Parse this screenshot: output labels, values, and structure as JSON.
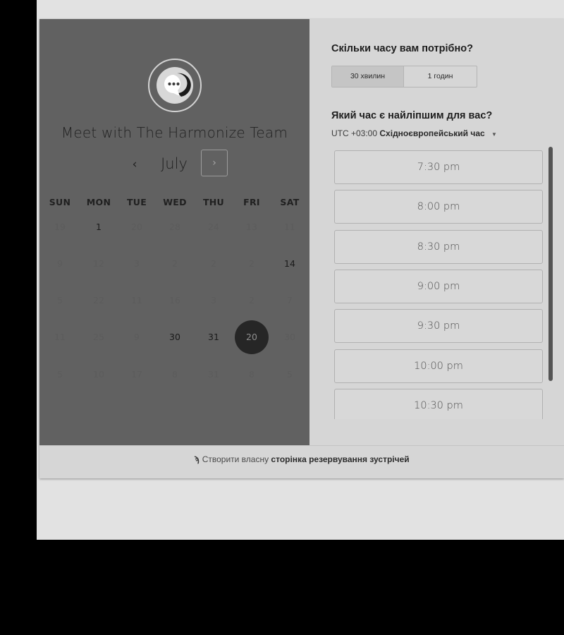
{
  "booking": {
    "title": "Meet with The Harmonize Team",
    "avatar_icon": "chat-bubble-icon",
    "calendar": {
      "month": "July",
      "prev_glyph": "‹",
      "next_glyph": "›",
      "weekdays": [
        "SUN",
        "MON",
        "TUE",
        "WED",
        "THU",
        "FRI",
        "SAT"
      ],
      "weeks": [
        [
          {
            "d": "19",
            "a": false
          },
          {
            "d": "1",
            "a": true
          },
          {
            "d": "20",
            "a": false
          },
          {
            "d": "28",
            "a": false
          },
          {
            "d": "24",
            "a": false
          },
          {
            "d": "13",
            "a": false
          },
          {
            "d": "11",
            "a": false
          }
        ],
        [
          {
            "d": "9",
            "a": false
          },
          {
            "d": "12",
            "a": false
          },
          {
            "d": "3",
            "a": false
          },
          {
            "d": "2",
            "a": false
          },
          {
            "d": "2",
            "a": false
          },
          {
            "d": "2",
            "a": false
          },
          {
            "d": "14",
            "a": true
          }
        ],
        [
          {
            "d": "5",
            "a": false
          },
          {
            "d": "22",
            "a": false
          },
          {
            "d": "11",
            "a": false
          },
          {
            "d": "16",
            "a": false
          },
          {
            "d": "3",
            "a": false
          },
          {
            "d": "2",
            "a": false
          },
          {
            "d": "7",
            "a": false
          }
        ],
        [
          {
            "d": "11",
            "a": false
          },
          {
            "d": "25",
            "a": false
          },
          {
            "d": "9",
            "a": false
          },
          {
            "d": "30",
            "a": true
          },
          {
            "d": "31",
            "a": true
          },
          {
            "d": "20",
            "a": true,
            "sel": true
          },
          {
            "d": "30",
            "a": false
          }
        ],
        [
          {
            "d": "5",
            "a": false
          },
          {
            "d": "10",
            "a": false
          },
          {
            "d": "17",
            "a": false
          },
          {
            "d": "8",
            "a": false
          },
          {
            "d": "31",
            "a": false
          },
          {
            "d": "8",
            "a": false
          },
          {
            "d": "5",
            "a": false
          }
        ]
      ]
    },
    "duration": {
      "heading": "Скільки часу вам потрібно?",
      "options": [
        "30 хвилин",
        "1 годин"
      ],
      "selected": 0
    },
    "time": {
      "heading": "Який час є найліпшим для вас?",
      "tz_prefix": "UTC +03:00",
      "tz_name": "Східноєвропейський час",
      "slots": [
        "7:30 pm",
        "8:00 pm",
        "8:30 pm",
        "9:00 pm",
        "9:30 pm",
        "10:00 pm",
        "10:30 pm"
      ]
    },
    "footer": {
      "icon": "hubspot-sprocket-icon",
      "glyph": "ϡ",
      "text_plain": "Створити власну",
      "text_bold": "сторінка резервування зустрічей"
    }
  }
}
